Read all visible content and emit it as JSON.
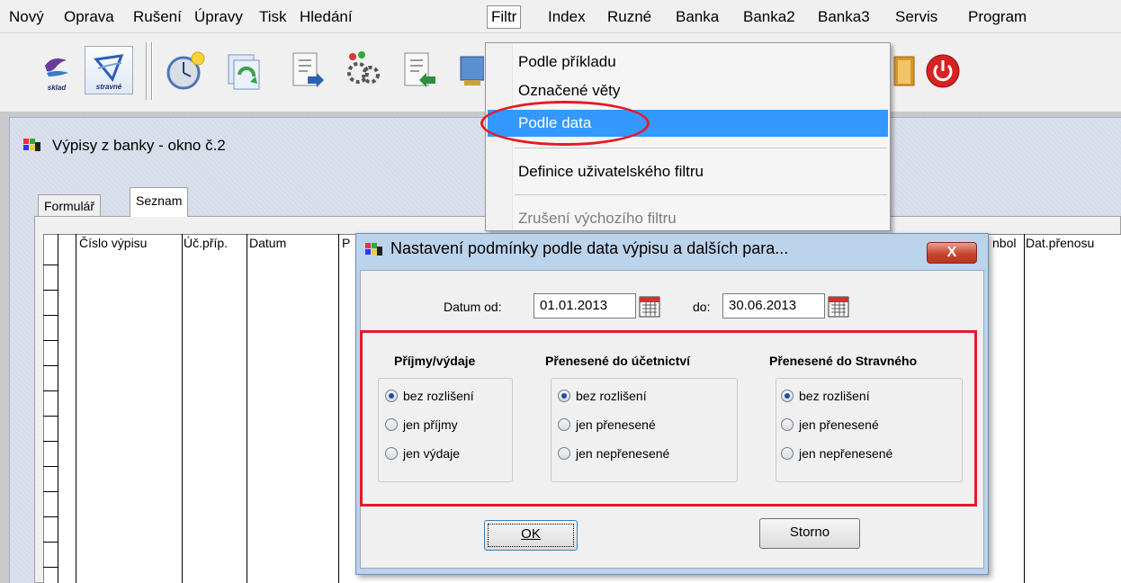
{
  "menu": {
    "items": [
      "Nový",
      "Oprava",
      "Rušení",
      "Úpravy",
      "Tisk",
      "Hledání",
      "Filtr",
      "Index",
      "Ruzné",
      "Banka",
      "Banka2",
      "Banka3",
      "Servis",
      "Program"
    ],
    "active": "Filtr"
  },
  "toolbar": {
    "sklad_caption": "sklad",
    "stravne_caption": "stravné"
  },
  "filter_menu": {
    "items": [
      {
        "label": "Podle příkladu",
        "state": "normal"
      },
      {
        "label": "Označené věty",
        "state": "normal"
      },
      {
        "label": "Podle data",
        "state": "highlighted"
      },
      {
        "label": "Definice uživatelského filtru",
        "state": "normal"
      },
      {
        "label": "Zrušení výchozího filtru",
        "state": "disabled"
      }
    ]
  },
  "window": {
    "title": "Výpisy z banky - okno č.2",
    "tabs": [
      "Formulář",
      "Seznam"
    ],
    "active_tab": "Seznam",
    "columns": [
      "Číslo výpisu",
      "Úč.příp.",
      "Datum",
      "P",
      "nbol",
      "Dat.přenosu"
    ]
  },
  "dialog": {
    "title": "Nastavení podmínky podle data výpisu a dalších para...",
    "close_label": "X",
    "date_from_label": "Datum od:",
    "date_from": "01.01.2013",
    "date_to_label": "do:",
    "date_to": "30.06.2013",
    "groups": [
      {
        "title": "Příjmy/výdaje",
        "options": [
          "bez rozlišení",
          "jen příjmy",
          "jen výdaje"
        ],
        "selected": 0
      },
      {
        "title": "Přenesené do účetnictví",
        "options": [
          "bez rozlišení",
          "jen přenesené",
          "jen nepřenesené"
        ],
        "selected": 0
      },
      {
        "title": "Přenesené do Stravného",
        "options": [
          "bez rozlišení",
          "jen přenesené",
          "jen nepřenesené"
        ],
        "selected": 0
      }
    ],
    "ok_label": "OK",
    "storno_label": "Storno"
  },
  "colors": {
    "highlight": "#3399ff",
    "annotation_red": "#e21b2a",
    "dialog_frame": "#bcd3ec"
  },
  "icons": [
    "sklad-icon",
    "stravne-icon",
    "clock-icon",
    "refresh-icon",
    "import-icon",
    "settings-icon",
    "export-icon",
    "monitor-icon",
    "folder-icon",
    "power-icon",
    "calendar-icon",
    "close-icon",
    "app-window-icon"
  ]
}
